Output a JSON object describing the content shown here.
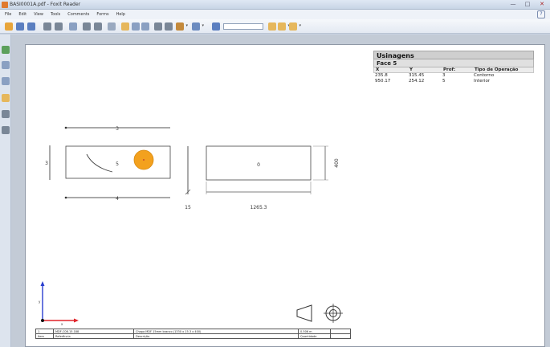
{
  "window": {
    "title": "BASI0001A.pdf - Foxit Reader",
    "controls": [
      "—",
      "□",
      "✕"
    ]
  },
  "menu": [
    "File",
    "Edit",
    "View",
    "Tools",
    "Comments",
    "Forms",
    "Help"
  ],
  "toolbar": {
    "icons": [
      {
        "name": "open-icon",
        "color": "#e8a53a"
      },
      {
        "name": "save-icon",
        "color": "#5b7fc0"
      },
      {
        "name": "save-as-icon",
        "color": "#5b7fc0"
      },
      {
        "name": "print-icon",
        "color": "#7a8797"
      },
      {
        "name": "email-icon",
        "color": "#7a8797"
      },
      {
        "name": "properties-icon",
        "color": "#8aa0c2"
      },
      {
        "name": "fit-page-icon",
        "color": "#7a8797"
      },
      {
        "name": "fit-width-icon",
        "color": "#7a8797"
      },
      {
        "name": "copy-icon",
        "color": "#9aaac0"
      },
      {
        "name": "hand-tool-icon",
        "color": "#e6b75c"
      },
      {
        "name": "select-tool-icon",
        "color": "#8aa0c2"
      },
      {
        "name": "snapshot-icon",
        "color": "#8aa0c2"
      },
      {
        "name": "zoom-in-icon",
        "color": "#7a8797"
      },
      {
        "name": "image-icon",
        "color": "#7a8797"
      },
      {
        "name": "stamp-icon",
        "color": "#c48a3c"
      },
      {
        "name": "pen-icon",
        "color": "#6c8cc0"
      },
      {
        "name": "find-icon",
        "color": "#5b7fc0"
      },
      {
        "name": "find-previous-icon",
        "color": "#e6b75c"
      },
      {
        "name": "find-next-icon",
        "color": "#e6b75c"
      },
      {
        "name": "find-options-icon",
        "color": "#e6b75c"
      }
    ],
    "find_text": ""
  },
  "sidebar": {
    "icons": [
      {
        "name": "bookmarks-icon",
        "color": "#5ca05c"
      },
      {
        "name": "pages-icon",
        "color": "#8aa0c2"
      },
      {
        "name": "layers-icon",
        "color": "#8aa0c2"
      },
      {
        "name": "comments-icon",
        "color": "#e6b75c"
      },
      {
        "name": "attachments-icon",
        "color": "#7a8797"
      },
      {
        "name": "signatures-icon",
        "color": "#7a8797"
      }
    ]
  },
  "drawing": {
    "dim_top": "3",
    "dim_left": "3",
    "dim_bottom": "4",
    "face_label": "5",
    "dim_thickness": "15",
    "side_label": "0",
    "dim_height": "400",
    "dim_length": "1265.3",
    "axis_y": "y",
    "axis_x": "x",
    "hole_color": "#f3a11e"
  },
  "panel": {
    "title": "Usinagens",
    "face": "Face 5",
    "columns": [
      "X",
      "Y",
      "Prof:",
      "Tipo de Operação"
    ],
    "rows": [
      [
        "235.8",
        "315.45",
        "3",
        "Contorno"
      ],
      [
        "950.17",
        "254.12",
        "5",
        "Interior"
      ]
    ]
  },
  "titleblock": {
    "row1": [
      "1",
      "MDF-C08.15.188",
      "Chapa MDF 15mm branco (1330 x 15.3 x 400)",
      "0.506 m",
      ""
    ],
    "row2": [
      "Item",
      "Referência",
      "Descrição",
      "Quantidade",
      ""
    ]
  }
}
